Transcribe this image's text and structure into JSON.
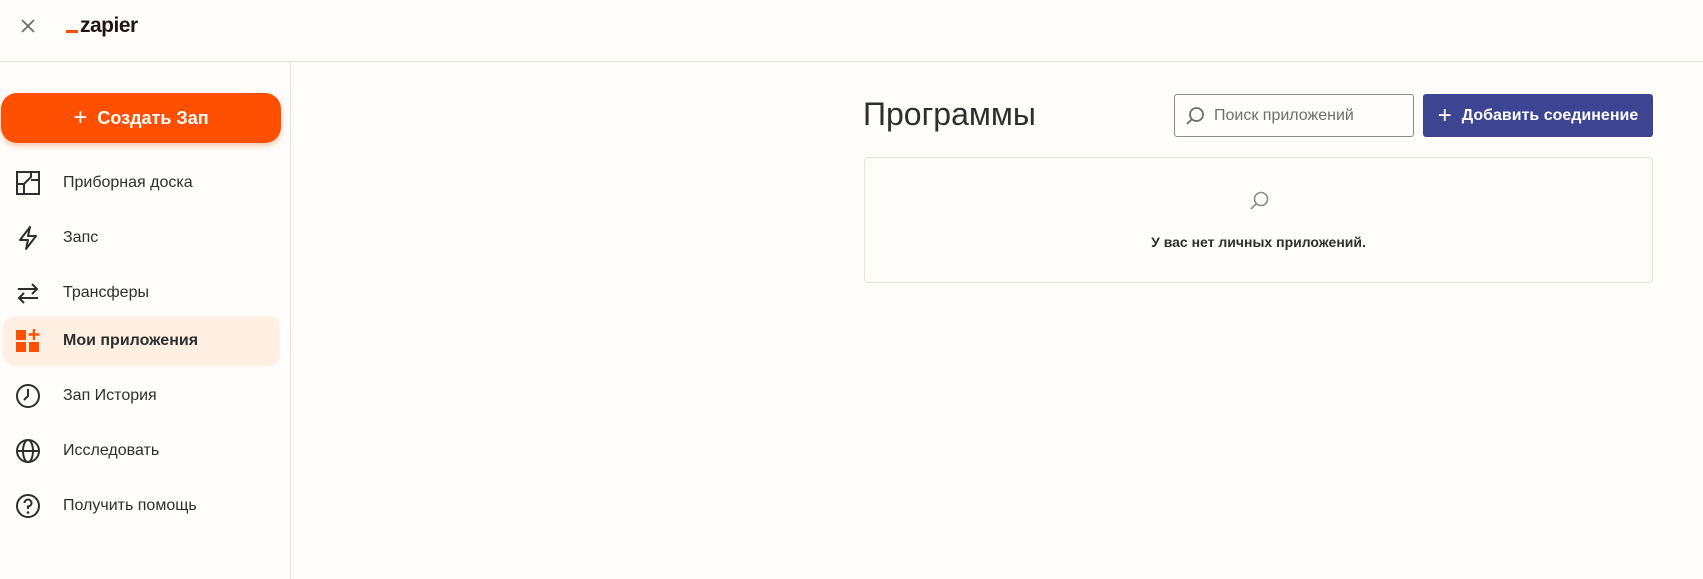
{
  "topbar": {
    "close_icon": "close-icon",
    "logo_text": "zapier",
    "brand_color": "#ff4f00"
  },
  "sidebar": {
    "create_button": {
      "label": "Создать Зап",
      "icon": "plus-icon",
      "color": "#ff4f00"
    },
    "items": [
      {
        "label": "Приборная доска",
        "icon": "dashboard-icon",
        "active": false
      },
      {
        "label": "Запс",
        "icon": "lightning-icon",
        "active": false
      },
      {
        "label": "Трансферы",
        "icon": "transfer-arrows-icon",
        "active": false
      },
      {
        "label": "Мои приложения",
        "icon": "apps-grid-icon",
        "active": true
      },
      {
        "label": "Зап История",
        "icon": "clock-icon",
        "active": false
      },
      {
        "label": "Исследовать",
        "icon": "globe-icon",
        "active": false
      },
      {
        "label": "Получить помощь",
        "icon": "help-icon",
        "active": false
      }
    ],
    "active_bg_color": "#fff0e3"
  },
  "main": {
    "title": "Программы",
    "search": {
      "placeholder": "Поиск приложений",
      "value": "",
      "icon": "search-icon"
    },
    "add_button": {
      "label": "Добавить соединение",
      "icon": "plus-icon",
      "color": "#3d4592"
    },
    "empty_state": {
      "icon": "search-icon",
      "message": "У вас нет личных приложений."
    }
  }
}
